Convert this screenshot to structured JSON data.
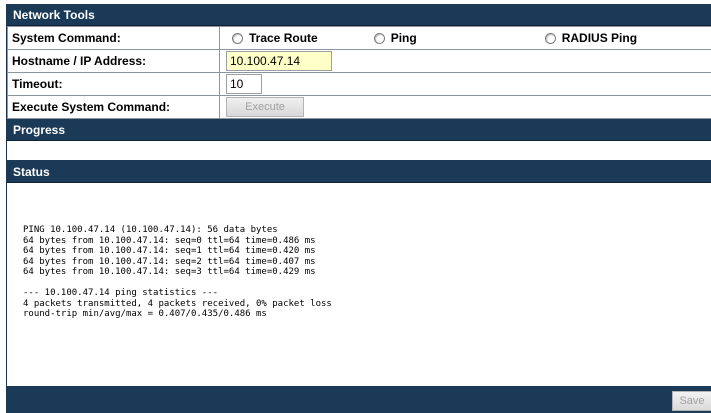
{
  "network_tools": {
    "title": "Network Tools",
    "system_command": {
      "label": "System Command:",
      "options": [
        "Trace Route",
        "Ping",
        "RADIUS Ping"
      ]
    },
    "hostname": {
      "label": "Hostname / IP Address:",
      "value": "10.100.47.14"
    },
    "timeout": {
      "label": "Timeout:",
      "value": "10"
    },
    "execute": {
      "label": "Execute System Command:",
      "button": "Execute"
    }
  },
  "progress": {
    "title": "Progress"
  },
  "status": {
    "title": "Status",
    "output": "PING 10.100.47.14 (10.100.47.14): 56 data bytes\n64 bytes from 10.100.47.14: seq=0 ttl=64 time=0.486 ms\n64 bytes from 10.100.47.14: seq=1 ttl=64 time=0.420 ms\n64 bytes from 10.100.47.14: seq=2 ttl=64 time=0.407 ms\n64 bytes from 10.100.47.14: seq=3 ttl=64 time=0.429 ms\n\n--- 10.100.47.14 ping statistics ---\n4 packets transmitted, 4 packets received, 0% packet loss\nround-trip min/avg/max = 0.407/0.435/0.486 ms"
  },
  "footer": {
    "save_label": "Save"
  },
  "colors": {
    "header_bg": "#1b3a57",
    "highlight_input": "#ffffc8"
  }
}
